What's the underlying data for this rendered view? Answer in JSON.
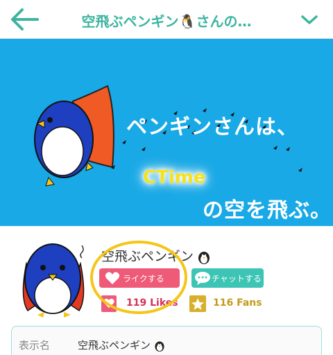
{
  "header": {
    "title": "空飛ぶペンギン🐧さんの…",
    "back_icon": "arrow-left-icon",
    "menu_icon": "chevron-down-icon"
  },
  "banner": {
    "line1": "ペンギンさんは、",
    "highlight": "CTime",
    "line2": "の空を飛ぶ。"
  },
  "profile": {
    "name": "空飛ぶペンギン",
    "like_button": "ライクする",
    "chat_button": "チャットする",
    "likes": "119 Likes",
    "fans": "116 Fans"
  },
  "info": {
    "label": "表示名",
    "value": "空飛ぶペンギン"
  },
  "colors": {
    "accent": "#3cb4a0",
    "banner_bg": "#18a9e6",
    "like": "#ee5a78",
    "chat": "#3cc4b4",
    "fans": "#d8ae2b",
    "highlight_ring": "#f5c518"
  }
}
